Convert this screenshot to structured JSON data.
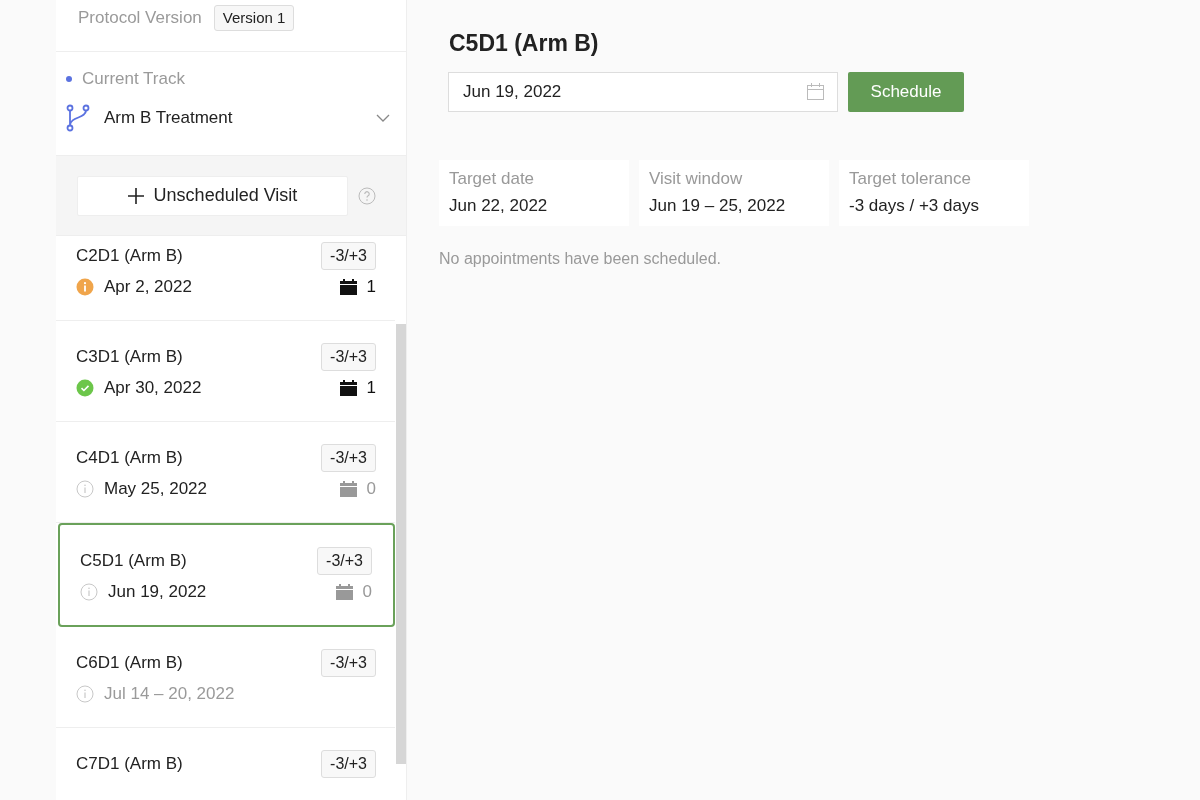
{
  "protocol": {
    "label": "Protocol Version",
    "version": "Version 1"
  },
  "track": {
    "label": "Current Track",
    "name": "Arm B Treatment",
    "expanded": false
  },
  "unscheduled_button": "Unscheduled Visit",
  "visits": [
    {
      "name": "C2D1 (Arm B)",
      "tolerance": "-3/+3",
      "kind": "warning",
      "date": "Apr 2, 2022",
      "date_muted": false,
      "count": "1",
      "count_active": true,
      "selected": false
    },
    {
      "name": "C3D1 (Arm B)",
      "tolerance": "-3/+3",
      "kind": "done",
      "date": "Apr 30, 2022",
      "date_muted": false,
      "count": "1",
      "count_active": true,
      "selected": false
    },
    {
      "name": "C4D1 (Arm B)",
      "tolerance": "-3/+3",
      "kind": "pending",
      "date": "May 25, 2022",
      "date_muted": false,
      "count": "0",
      "count_active": false,
      "selected": false
    },
    {
      "name": "C5D1 (Arm B)",
      "tolerance": "-3/+3",
      "kind": "pending",
      "date": "Jun 19, 2022",
      "date_muted": false,
      "count": "0",
      "count_active": false,
      "selected": true
    },
    {
      "name": "C6D1 (Arm B)",
      "tolerance": "-3/+3",
      "kind": "pending",
      "date": "Jul 14 – 20, 2022",
      "date_muted": true,
      "selected": false
    },
    {
      "name": "C7D1 (Arm B)",
      "tolerance": "-3/+3",
      "selected": false
    }
  ],
  "detail": {
    "title": "C5D1 (Arm B)",
    "date_value": "Jun 19, 2022",
    "schedule_button": "Schedule",
    "facts": [
      {
        "label": "Target date",
        "value": "Jun 22, 2022"
      },
      {
        "label": "Visit window",
        "value": "Jun 19 – 25, 2022"
      },
      {
        "label": "Target tolerance",
        "value": "-3 days / +3 days"
      }
    ],
    "empty_message": "No appointments have been scheduled."
  }
}
